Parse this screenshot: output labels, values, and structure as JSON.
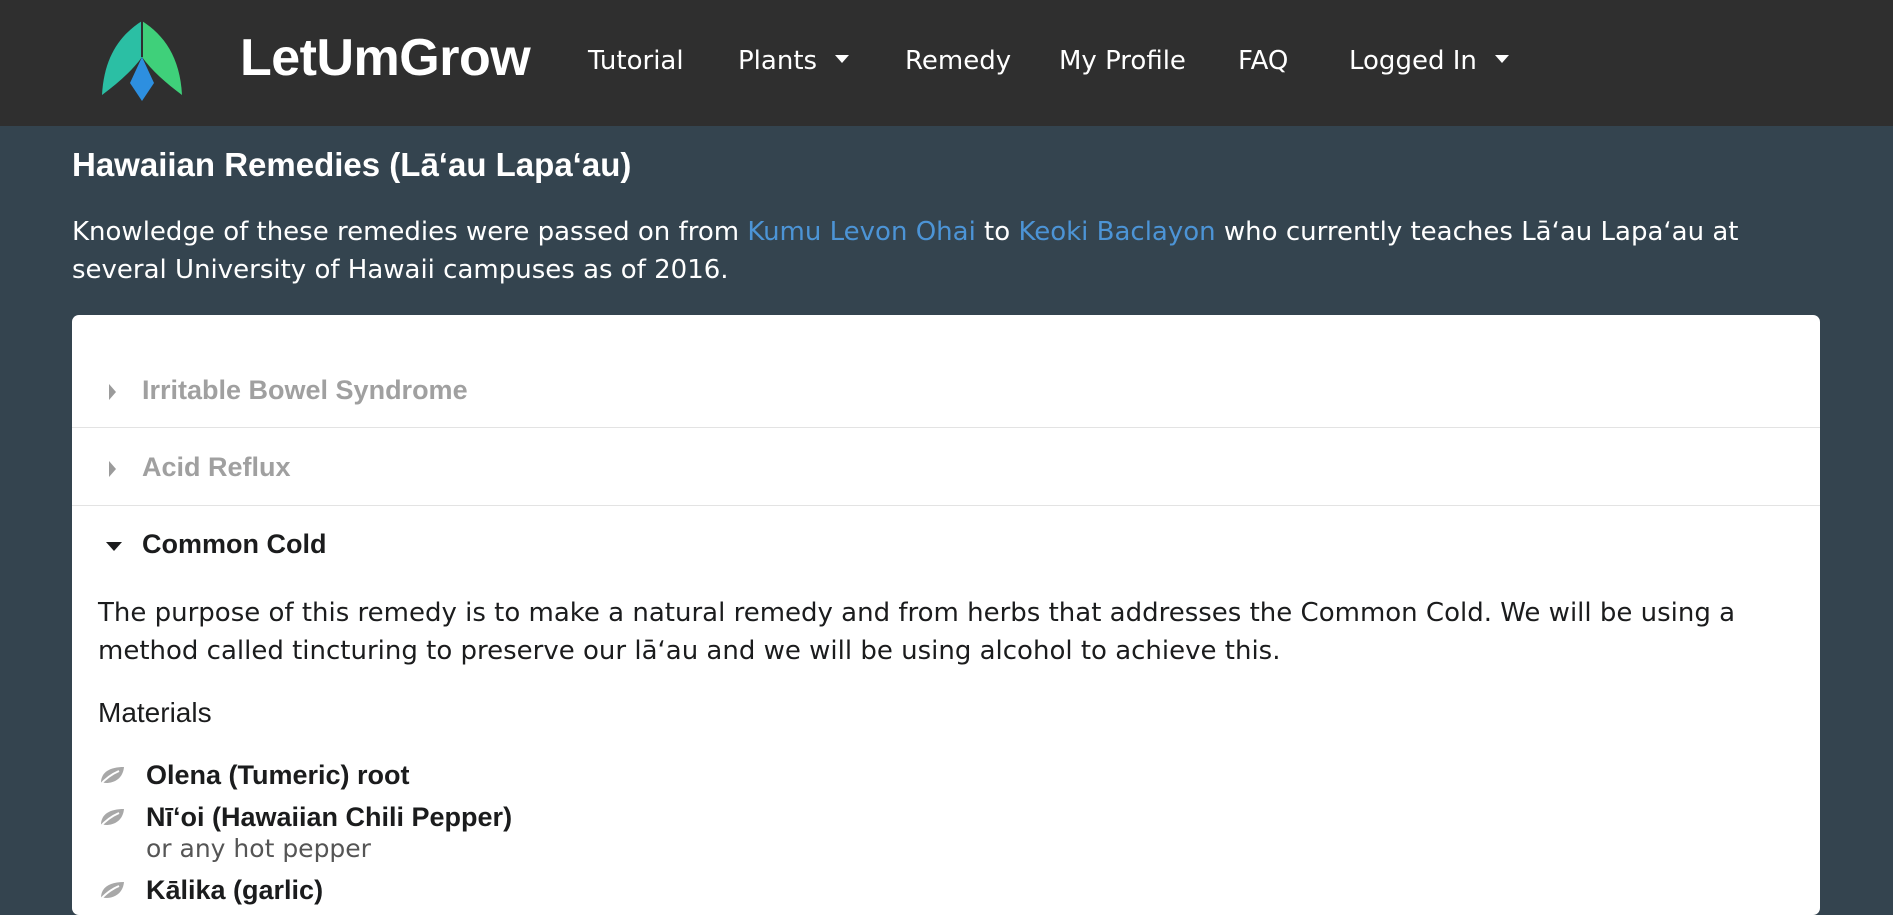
{
  "nav": {
    "brand": "LetUmGrow",
    "items": [
      {
        "label": "Tutorial"
      },
      {
        "label": "Plants"
      },
      {
        "label": "Remedy"
      },
      {
        "label": "My Profile"
      },
      {
        "label": "FAQ"
      },
      {
        "label": "Logged In"
      }
    ]
  },
  "page": {
    "title": "Hawaiian Remedies (Lāʻau Lapaʻau)",
    "intro_before": "Knowledge of these remedies were passed on from ",
    "link1": "Kumu Levon Ohai",
    "intro_mid": " to ",
    "link2": "Keoki Baclayon",
    "intro_after": " who currently teaches Lāʻau Lapaʻau at several University of Hawaii campuses as of 2016."
  },
  "accordion": {
    "items": [
      {
        "title": "Irritable Bowel Syndrome",
        "expanded": false
      },
      {
        "title": "Acid Reflux",
        "expanded": false
      },
      {
        "title": "Common Cold",
        "expanded": true
      }
    ],
    "content": "The purpose of this remedy is to make a natural remedy and from herbs that addresses the Common Cold. We will be using a method called tincturing to preserve our lāʻau and we will be using alcohol to achieve this.",
    "materials_heading": "Materials",
    "materials": [
      {
        "name": "Olena (Tumeric) root",
        "note": ""
      },
      {
        "name": "Nīʻoi (Hawaiian Chili Pepper)",
        "note": "or any hot pepper"
      },
      {
        "name": "Kālika (garlic)",
        "note": ""
      }
    ]
  },
  "colors": {
    "navbar": "#2f2f2f",
    "page_bg": "#34444f",
    "link": "#4c94d6",
    "logo_teal": "#2bbfa4",
    "logo_green": "#3fd07a",
    "logo_blue": "#2d8fe0"
  },
  "icons": {
    "material_item": "leaf-icon",
    "collapsed": "caret-right-icon",
    "expanded": "caret-down-icon"
  }
}
